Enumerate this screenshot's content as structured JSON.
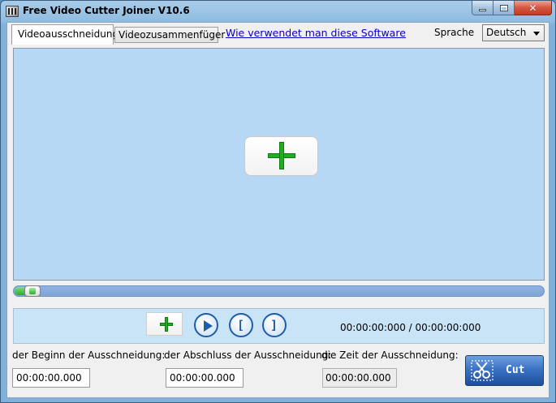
{
  "window": {
    "title": "Free Video Cutter Joiner V10.6"
  },
  "tabs": [
    {
      "label": "Videoausschneidung"
    },
    {
      "label": "Videozusammenfüger"
    }
  ],
  "help_link": "Wie verwendet man diese Software",
  "language": {
    "label": "Sprache",
    "selected": "Deutsch"
  },
  "player": {
    "progress": 0.02,
    "timecode": "00:00:00:000 / 00:00:00:000"
  },
  "fields": {
    "start_label": "der Beginn der Ausschneidung:",
    "start_value": "00:00:00.000",
    "end_label": "der Abschluss der Ausschneidung:",
    "end_value": "00:00:00.000",
    "duration_label": "die Zeit der Ausschneidung:",
    "duration_value": "00:00:00.000"
  },
  "cut_button": {
    "label": "Cut"
  },
  "colors": {
    "accent_green": "#1fae1f",
    "button_blue": "#1e5ea8",
    "video_bg": "#b7d8f4"
  }
}
